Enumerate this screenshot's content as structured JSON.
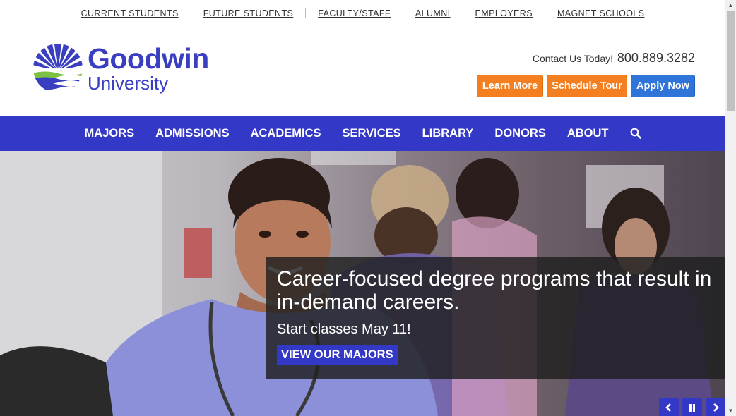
{
  "utility_nav": [
    "CURRENT STUDENTS",
    "FUTURE STUDENTS",
    "FACULTY/STAFF",
    "ALUMNI",
    "EMPLOYERS",
    "MAGNET SCHOOLS"
  ],
  "logo": {
    "name": "Goodwin",
    "sub": "University"
  },
  "contact": {
    "label": "Contact Us Today!",
    "phone": "800.889.3282"
  },
  "cta": {
    "learn_more": "Learn More",
    "schedule_tour": "Schedule Tour",
    "apply_now": "Apply Now"
  },
  "main_nav": [
    "MAJORS",
    "ADMISSIONS",
    "ACADEMICS",
    "SERVICES",
    "LIBRARY",
    "DONORS",
    "ABOUT"
  ],
  "hero": {
    "headline": "Career-focused degree programs that result in in-demand careers.",
    "subtext": "Start classes May 11!",
    "button": "VIEW OUR MAJORS"
  },
  "icons": {
    "search": "search-icon",
    "prev": "chevron-left-icon",
    "pause": "pause-icon",
    "next": "chevron-right-icon"
  },
  "colors": {
    "brand_blue": "#3338c6",
    "cta_orange": "#f47f20",
    "cta_blue": "#2f74d8",
    "logo_green": "#7cc242"
  }
}
